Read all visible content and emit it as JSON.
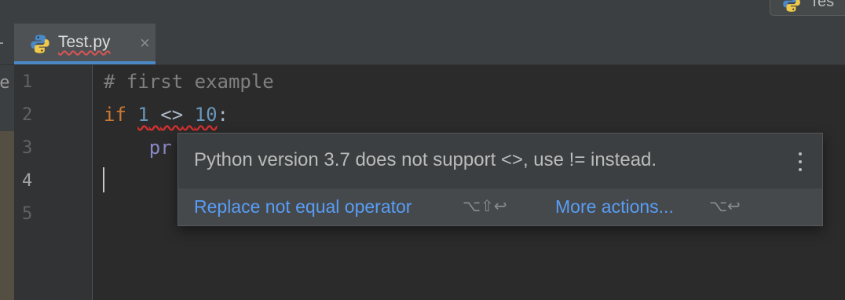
{
  "colors": {
    "editor_bg": "#2b2b2b",
    "keyword": "#cc7832",
    "number": "#6897bb",
    "comment": "#808080",
    "link": "#589df6",
    "error_underline": "#d83030",
    "tab_underline": "#4a88c7"
  },
  "run_config": {
    "label": "Tes",
    "icon": "python-icon"
  },
  "tabs": [
    {
      "label": "Test.py",
      "icon": "python-icon",
      "close_glyph": "×"
    }
  ],
  "left_strip": {
    "clipped_text": "Me"
  },
  "editor": {
    "line_numbers": [
      "1",
      "2",
      "3",
      "4",
      "5"
    ],
    "lines": {
      "l1": {
        "comment": "# first example"
      },
      "l2": {
        "keyword": "if",
        "num1": "1",
        "op": "<>",
        "num2": "10",
        "colon": ":"
      },
      "l3": {
        "partial": "pr"
      }
    }
  },
  "popup": {
    "message": "Python version 3.7 does not support <>, use != instead.",
    "actions": [
      {
        "label": "Replace not equal operator",
        "shortcut": "⌥⇧↩"
      },
      {
        "label": "More actions...",
        "shortcut": "⌥↩"
      }
    ]
  }
}
